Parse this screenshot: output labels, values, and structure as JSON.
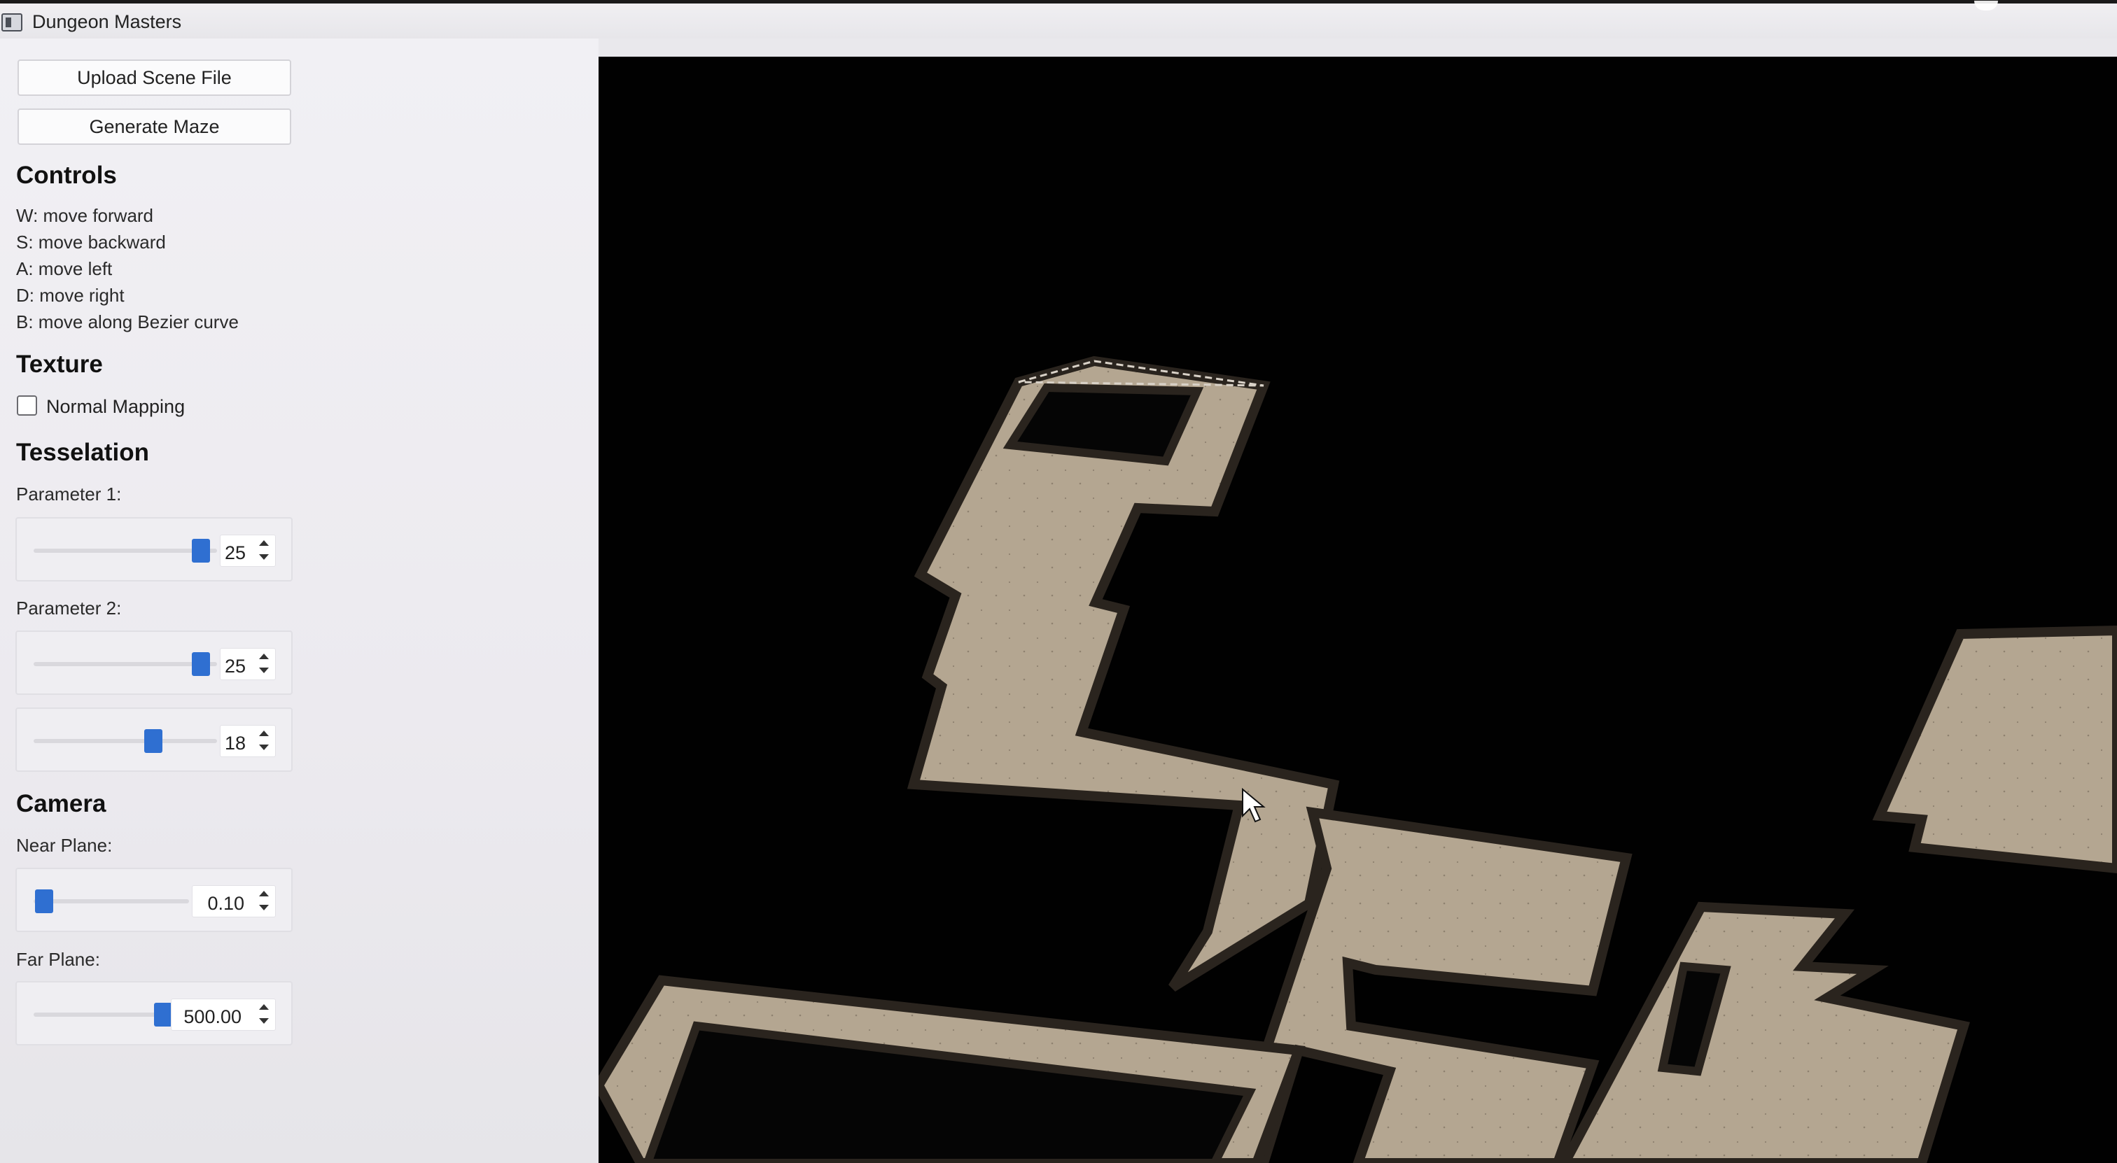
{
  "window": {
    "title": "Dungeon Masters"
  },
  "buttons": {
    "upload": "Upload Scene File",
    "generate": "Generate Maze"
  },
  "controls": {
    "heading": "Controls",
    "lines": [
      "W: move forward",
      "S: move backward",
      "A: move left",
      "D: move right",
      "B: move along Bezier curve"
    ]
  },
  "texture": {
    "heading": "Texture",
    "normal_mapping_label": "Normal Mapping",
    "normal_mapping_checked": false
  },
  "tesselation": {
    "heading": "Tesselation",
    "param1_label": "Parameter 1:",
    "param1_value": "25",
    "param2_label": "Parameter 2:",
    "param2_value": "25",
    "param3_value": "18"
  },
  "camera": {
    "heading": "Camera",
    "near_label": "Near Plane:",
    "near_value": "0.10",
    "far_label": "Far Plane:",
    "far_value": "500.00"
  },
  "colors": {
    "slider_accent": "#2f6fd1",
    "viewport_bg": "#010101",
    "floor": "#b4a691",
    "wall_top": "#d9d2c8",
    "wall_side": "#2a241e"
  },
  "icons": {
    "window_icon": "app-window-icon",
    "cursor": "mouse-pointer-icon"
  }
}
